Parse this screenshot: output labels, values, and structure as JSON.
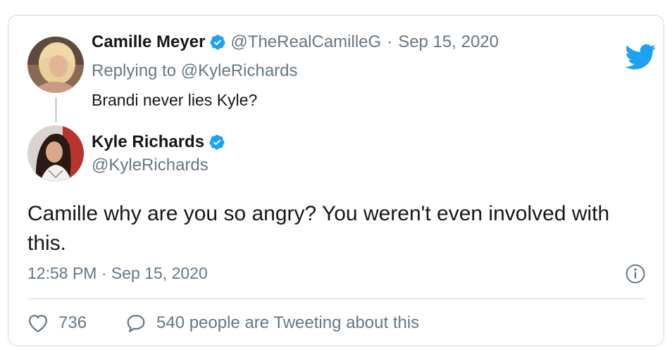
{
  "quoted_tweet": {
    "author_name": "Camille Meyer",
    "author_handle": "@TheRealCamilleG",
    "separator": "·",
    "date": "Sep 15, 2020",
    "replying_prefix": "Replying to ",
    "replying_to": "@KyleRichards",
    "text": "Brandi never lies Kyle?"
  },
  "main_tweet": {
    "author_name": "Kyle Richards",
    "author_handle": "@KyleRichards",
    "text": "Camille why are you so angry? You weren't even involved with this.",
    "timestamp": "12:58 PM · Sep 15, 2020"
  },
  "actions": {
    "likes": "736",
    "tweeting_about": "540 people are Tweeting about this"
  },
  "colors": {
    "accent": "#1da1f2",
    "muted": "#657786",
    "border": "#cfd9de",
    "text": "#14171a"
  },
  "icons": [
    "twitter-bird-icon",
    "verified-badge-icon",
    "info-icon",
    "heart-icon",
    "reply-bubble-icon"
  ]
}
